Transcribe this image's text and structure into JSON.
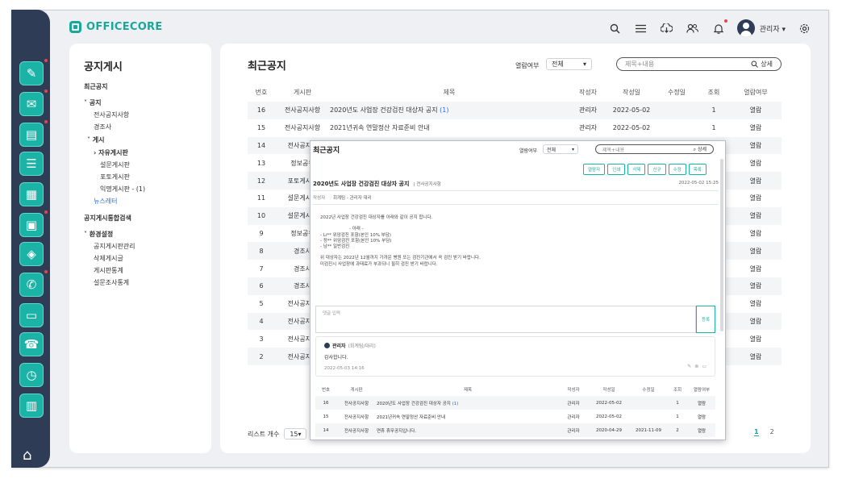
{
  "app": {
    "brand": "OFFICECORE",
    "user_name": "관리자 ▾"
  },
  "header_icons": [
    "search-icon",
    "list-icon",
    "cloud-download-icon",
    "users-icon",
    "bell-icon",
    "gear-icon"
  ],
  "rail": {
    "items": [
      {
        "name": "approval",
        "icon": "✎",
        "badge": true
      },
      {
        "name": "mail",
        "icon": "✉",
        "badge": true
      },
      {
        "name": "board",
        "icon": "▤",
        "badge": true
      },
      {
        "name": "schedule",
        "icon": "☰",
        "badge": false
      },
      {
        "name": "apps",
        "icon": "▦",
        "badge": false
      },
      {
        "name": "work",
        "icon": "▣",
        "badge": true
      },
      {
        "name": "layers",
        "icon": "◈",
        "badge": false
      },
      {
        "name": "notice",
        "icon": "✆",
        "badge": true
      },
      {
        "name": "folder",
        "icon": "▭",
        "badge": false
      },
      {
        "name": "contacts",
        "icon": "☎",
        "badge": false
      },
      {
        "name": "clock",
        "icon": "◷",
        "badge": false
      },
      {
        "name": "kanban",
        "icon": "▥",
        "badge": false
      }
    ],
    "home": "⌂"
  },
  "sidebar": {
    "title": "공지게시",
    "items": [
      {
        "label": "최근공지",
        "style": "bold"
      },
      {
        "label": "˅  공지",
        "style": "bold"
      },
      {
        "label": "전사공지사항",
        "style": ""
      },
      {
        "label": "경조사",
        "style": ""
      },
      {
        "label": "˅  게시",
        "style": "bold"
      },
      {
        "label": "›  자유게시판",
        "style": "bold"
      },
      {
        "label": "설문게시판",
        "style": ""
      },
      {
        "label": "포토게시판",
        "style": ""
      },
      {
        "label": "익명게시판 - (1)",
        "style": ""
      },
      {
        "label": "뉴스레터",
        "style": "link"
      },
      {
        "label": "공지게시통합검색",
        "style": "bold"
      },
      {
        "label": "˅  환경설정",
        "style": "bold"
      },
      {
        "label": "공지게시판관리",
        "style": ""
      },
      {
        "label": "삭제게시글",
        "style": ""
      },
      {
        "label": "게시판통계",
        "style": ""
      },
      {
        "label": "설문조사통계",
        "style": ""
      }
    ]
  },
  "main": {
    "title": "최근공지",
    "filter_label": "열람여부",
    "filter_value": "전체",
    "search_placeholder": "제목+내용",
    "search_button": "상세",
    "columns": [
      "번호",
      "게시판",
      "제목",
      "작성자",
      "작성일",
      "수정일",
      "조회",
      "열람여부"
    ],
    "rows": [
      [
        "16",
        "전사공지사항",
        "2020년도 사업장 건강검진 대상자 공지",
        "관리자",
        "2022-05-02",
        "",
        "1",
        "열람",
        "(1)"
      ],
      [
        "15",
        "전사공지사항",
        "2021년귀속 연말정산 자료준비 안내",
        "관리자",
        "2022-05-02",
        "",
        "1",
        "열람",
        ""
      ],
      [
        "14",
        "전사공지사",
        "",
        "",
        "",
        "",
        "",
        "열람",
        ""
      ],
      [
        "13",
        "정보공유",
        "",
        "",
        "",
        "",
        "",
        "열람",
        ""
      ],
      [
        "12",
        "포토게시판",
        "",
        "",
        "",
        "",
        "",
        "열람",
        ""
      ],
      [
        "11",
        "설문게시판",
        "",
        "",
        "",
        "",
        "",
        "열람",
        ""
      ],
      [
        "10",
        "설문게시판",
        "",
        "",
        "",
        "",
        "",
        "열람",
        ""
      ],
      [
        "9",
        "정보공유",
        "",
        "",
        "",
        "",
        "",
        "열람",
        ""
      ],
      [
        "8",
        "경조사",
        "",
        "",
        "",
        "",
        "",
        "열람",
        ""
      ],
      [
        "7",
        "경조사",
        "",
        "",
        "",
        "",
        "",
        "열람",
        ""
      ],
      [
        "6",
        "경조사",
        "",
        "",
        "",
        "",
        "",
        "열람",
        ""
      ],
      [
        "5",
        "전사공지사",
        "",
        "",
        "",
        "",
        "",
        "열람",
        ""
      ],
      [
        "4",
        "전사공지사",
        "",
        "",
        "",
        "",
        "",
        "열람",
        ""
      ],
      [
        "3",
        "전사공지사",
        "",
        "",
        "",
        "",
        "",
        "열람",
        ""
      ],
      [
        "2",
        "전사공지사",
        "",
        "",
        "",
        "",
        "",
        "열람",
        ""
      ]
    ],
    "list_count_label": "리스트 개수",
    "list_count_value": "15",
    "pages": [
      "1",
      "2"
    ],
    "current_page": "1"
  },
  "popup": {
    "title": "최근공지",
    "filter_label": "열람여부",
    "filter_value": "전체",
    "search_placeholder": "제목+내용",
    "search_button": "상세",
    "actions": [
      "열람자",
      "인쇄",
      "삭제",
      "신규",
      "수정",
      "목록"
    ],
    "post_title": "2020년도 사업장 건강검진 대상자 공지",
    "post_category": "| 전사공지사항",
    "post_date": "2022-05-02 15:25",
    "author_label": "작성자",
    "author_value": "회계팀 - 관리자 대리",
    "body_lines": [
      "2022년 사업장 건강검진 대상자를 아래와 같이 공지 합니다.",
      "",
      "- 아래 -",
      "- Li**  위암검진 포함(본인 10% 부담)",
      "- 정**  위암검진 포함(본인 10% 부담)",
      "- 남**  일반검진",
      "",
      "위 대상자는 2022년 12월까지 가까운 병원 또는 검진기관에서 꼭 검진 받기 바랍니다.",
      "미검진시 사업장에 과태료가 부과되니 필히 검진 받기 바랍니다."
    ],
    "comment_placeholder": "댓글 입력",
    "register_button": "등록",
    "comment": {
      "author": "관리자",
      "dept": "(회계팀/대리)",
      "text": "감사합니다.",
      "date": "2022-05-03 14:16"
    },
    "columns": [
      "번호",
      "게시판",
      "제목",
      "작성자",
      "작성일",
      "수정일",
      "조회",
      "열람여부"
    ],
    "rows": [
      [
        "16",
        "전사공지사항",
        "2020년도 사업장 건강검진 대상자 공지",
        "관리자",
        "2022-05-02",
        "",
        "1",
        "열람",
        "(1)"
      ],
      [
        "15",
        "전사공지사항",
        "2021년귀속 연말정산 자료준비 안내",
        "관리자",
        "2022-05-02",
        "",
        "1",
        "열람",
        ""
      ],
      [
        "14",
        "전사공지사항",
        "연휴 휴무공지입니다.",
        "관리자",
        "2020-04-29",
        "2021-11-09",
        "2",
        "열람",
        ""
      ]
    ]
  },
  "colors": {
    "accent": "#17a89a",
    "rail": "#2f3c56",
    "link": "#2d6cdf"
  }
}
